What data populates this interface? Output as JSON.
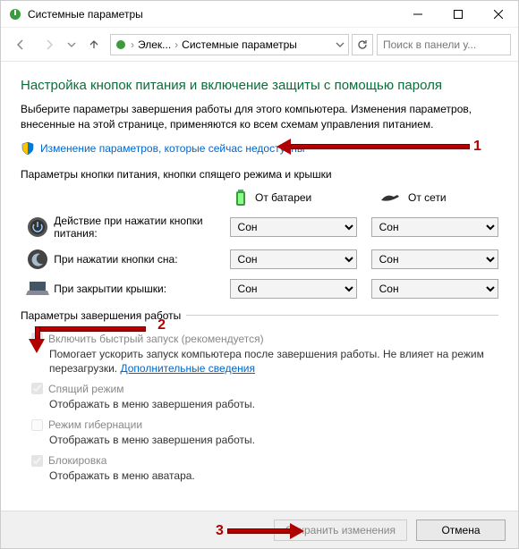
{
  "window": {
    "title": "Системные параметры",
    "search_placeholder": "Поиск в панели у..."
  },
  "breadcrumb": {
    "item1": "Элек...",
    "item2": "Системные параметры"
  },
  "heading": "Настройка кнопок питания и включение защиты с помощью пароля",
  "intro": "Выберите параметры завершения работы для этого компьютера. Изменения параметров, внесенные на этой странице, применяются ко всем схемам управления питанием.",
  "change_link": "Изменение параметров, которые сейчас недоступны",
  "section1_label": "Параметры кнопки питания, кнопки спящего режима и крышки",
  "col_battery": "От батареи",
  "col_ac": "От сети",
  "rows": [
    {
      "label": "Действие при нажатии кнопки питания:",
      "battery": "Сон",
      "ac": "Сон"
    },
    {
      "label": "При нажатии кнопки сна:",
      "battery": "Сон",
      "ac": "Сон"
    },
    {
      "label": "При закрытии крышки:",
      "battery": "Сон",
      "ac": "Сон"
    }
  ],
  "select_option": "Сон",
  "section2_label": "Параметры завершения работы",
  "opts": {
    "fast": {
      "label": "Включить быстрый запуск (рекомендуется)",
      "desc": "Помогает ускорить запуск компьютера после завершения работы. Не влияет на режим перезагрузки.",
      "more": "Дополнительные сведения"
    },
    "sleep": {
      "label": "Спящий режим",
      "desc": "Отображать в меню завершения работы."
    },
    "hiber": {
      "label": "Режим гибернации",
      "desc": "Отображать в меню завершения работы."
    },
    "lock": {
      "label": "Блокировка",
      "desc": "Отображать в меню аватара."
    }
  },
  "buttons": {
    "save": "Сохранить изменения",
    "cancel": "Отмена"
  },
  "annotations": {
    "n1": "1",
    "n2": "2",
    "n3": "3"
  }
}
